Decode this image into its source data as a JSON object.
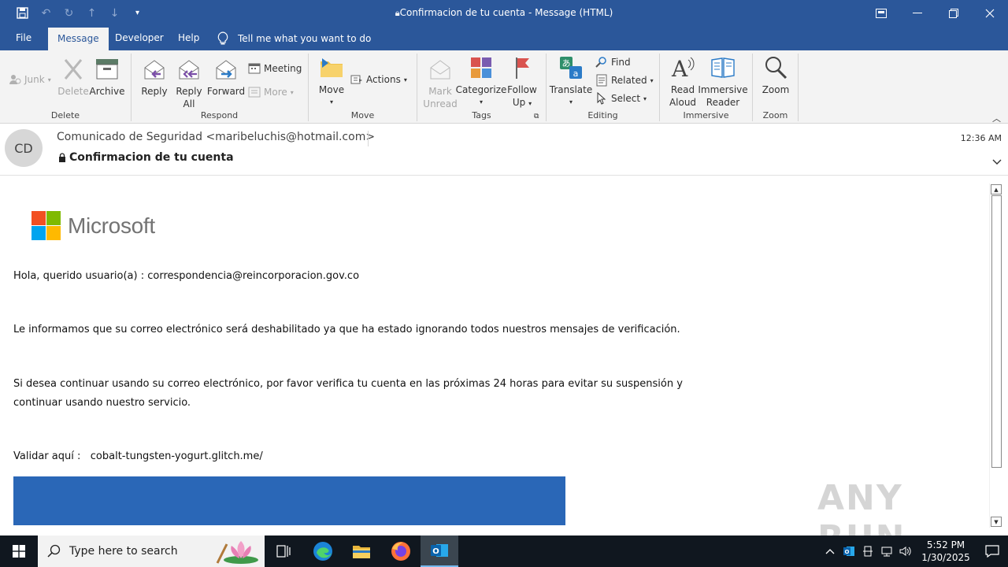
{
  "window": {
    "title": "Confirmacion de tu cuenta  -  Message (HTML)"
  },
  "tabs": [
    {
      "label": "File"
    },
    {
      "label": "Message"
    },
    {
      "label": "Developer"
    },
    {
      "label": "Help"
    }
  ],
  "tell_me": "Tell me what you want to do",
  "ribbon": {
    "junk": "Junk",
    "delete": "Delete",
    "archive": "Archive",
    "reply": "Reply",
    "reply_all_1": "Reply",
    "reply_all_2": "All",
    "forward": "Forward",
    "meeting": "Meeting",
    "more": "More",
    "move": "Move",
    "actions": "Actions",
    "mark_unread_1": "Mark",
    "mark_unread_2": "Unread",
    "categorize": "Categorize",
    "follow_up_1": "Follow",
    "follow_up_2": "Up",
    "translate": "Translate",
    "find": "Find",
    "related": "Related",
    "select": "Select",
    "read_aloud_1": "Read",
    "read_aloud_2": "Aloud",
    "immersive_1": "Immersive",
    "immersive_2": "Reader",
    "zoom": "Zoom",
    "groups": {
      "delete": "Delete",
      "respond": "Respond",
      "move": "Move",
      "tags": "Tags",
      "editing": "Editing",
      "immersive": "Immersive",
      "zoom": "Zoom"
    }
  },
  "message": {
    "avatar_initials": "CD",
    "sender": "Comunicado de Seguridad <maribeluchis@hotmail.com>",
    "subject": "Confirmacion de tu cuenta",
    "time": "12:36 AM"
  },
  "body": {
    "logo_text": "Microsoft",
    "greeting": "Hola, querido usuario(a) : correspondencia@reincorporacion.gov.co",
    "p1": "Le informamos que su correo electrónico será deshabilitado ya que ha estado ignorando todos nuestros mensajes de verificación.",
    "p2": "Si desea continuar usando su correo electrónico, por favor verifica tu cuenta en las próximas 24 horas para evitar su suspensión y continuar usando nuestro servicio.",
    "validate_label": "Validar aquí :",
    "validate_link": "cobalt-tungsten-yogurt.glitch.me/"
  },
  "watermark": "ANY RUN",
  "taskbar": {
    "search_placeholder": "Type here to search",
    "time": "5:52 PM",
    "date": "1/30/2025"
  },
  "colors": {
    "brand": "#2b579a",
    "ms_red": "#f25022",
    "ms_green": "#7fba00",
    "ms_blue": "#00a4ef",
    "ms_yellow": "#ffb900"
  }
}
